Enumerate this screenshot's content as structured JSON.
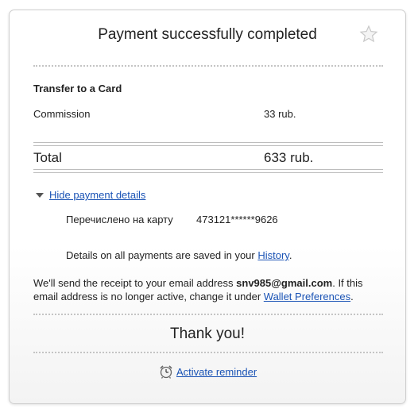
{
  "header": {
    "title": "Payment successfully completed",
    "favorite_icon": "star-icon"
  },
  "transfer": {
    "section_title": "Transfer to a Card",
    "commission_label": "Commission",
    "commission_value": "33 rub.",
    "total_label": "Total",
    "total_value": "633 rub."
  },
  "details": {
    "toggle_label": "Hide payment details",
    "card_label": "Перечислено на карту",
    "card_number": "473121******9626",
    "saved_prefix": "Details on all payments are saved in your ",
    "history_link": "History",
    "saved_suffix": "."
  },
  "receipt": {
    "prefix": "We'll send the receipt to your email address ",
    "email": "snv985@gmail.com",
    "middle": ". If this email address is no longer active, change it under ",
    "preferences_link": "Wallet Preferences",
    "suffix": "."
  },
  "footer": {
    "thanks": "Thank you!",
    "reminder_link": "Activate reminder",
    "reminder_icon": "alarm-clock-icon"
  },
  "colors": {
    "link": "#1a53b5",
    "text": "#222222",
    "border": "#cfcfcf"
  }
}
